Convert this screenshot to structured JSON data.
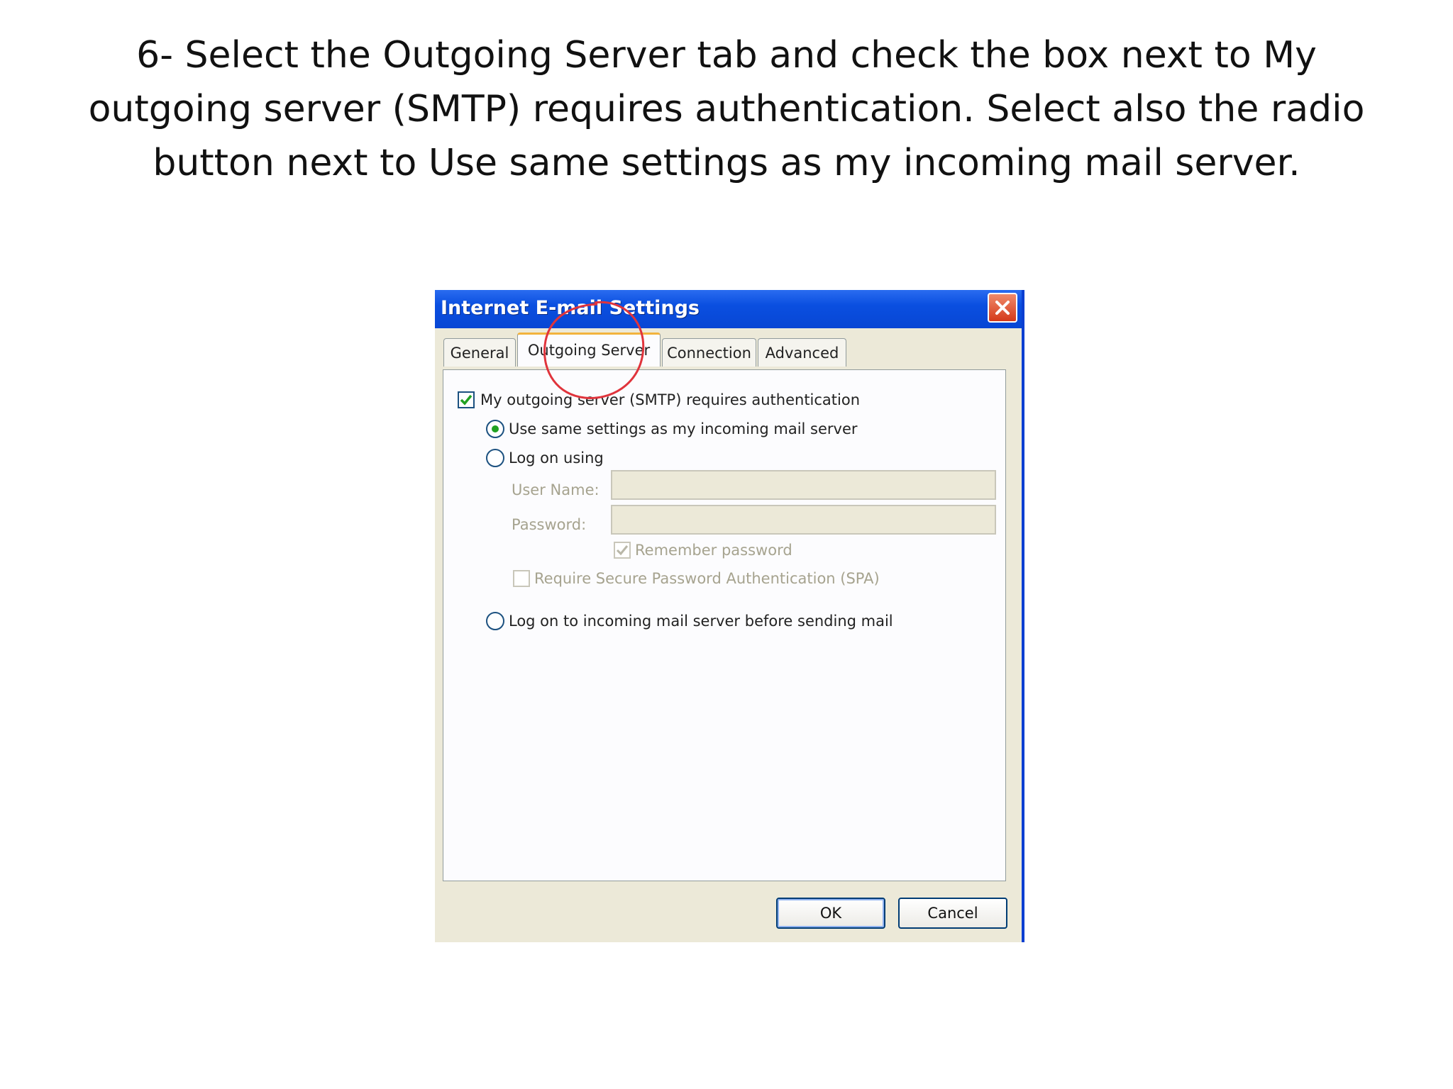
{
  "instruction": {
    "line1": "6- Select the Outgoing Server tab and check the box next to My",
    "line2": "outgoing server (SMTP) requires authentication. Select also the radio",
    "line3": "button next to Use same settings as my incoming mail server."
  },
  "dialog": {
    "title": "Internet E-mail Settings",
    "close_icon": "close-icon",
    "tabs": [
      {
        "label": "General",
        "active": false
      },
      {
        "label": "Outgoing Server",
        "active": true
      },
      {
        "label": "Connection",
        "active": false
      },
      {
        "label": "Advanced",
        "active": false
      }
    ],
    "smtp_auth": {
      "label": "My outgoing server (SMTP) requires authentication",
      "checked": true
    },
    "use_same": {
      "label": "Use same settings as my incoming mail server",
      "selected": true
    },
    "log_on_using": {
      "label": "Log on using",
      "selected": false
    },
    "user_name": {
      "label": "User Name:",
      "value": ""
    },
    "password": {
      "label": "Password:",
      "value": ""
    },
    "remember_password": {
      "label": "Remember password",
      "checked": true,
      "enabled": false
    },
    "require_spa": {
      "label": "Require Secure Password Authentication (SPA)",
      "checked": false,
      "enabled": false
    },
    "log_on_incoming": {
      "label": "Log on to incoming mail server before sending mail",
      "selected": false
    },
    "ok_label": "OK",
    "cancel_label": "Cancel"
  },
  "colors": {
    "titlebar": "#0a4fe0",
    "dialog_bg": "#ece9d8",
    "annotation": "#e0343c",
    "check": "#21a121"
  }
}
